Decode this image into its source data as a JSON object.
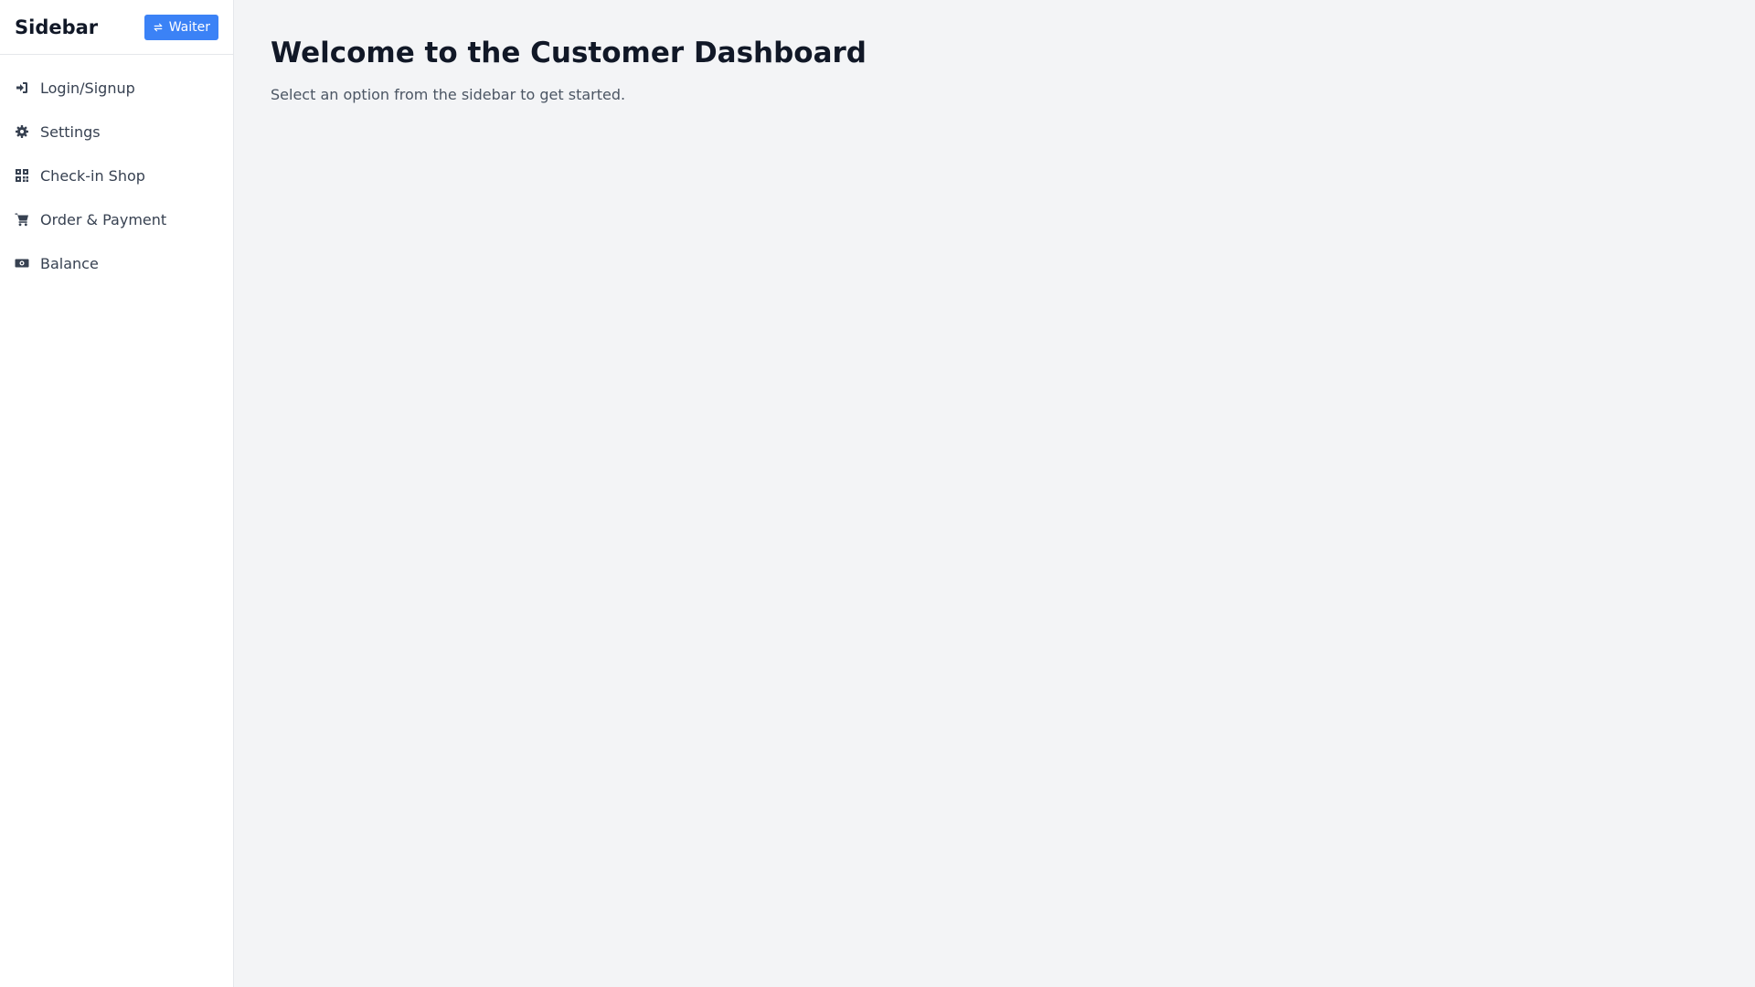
{
  "sidebar": {
    "title": "Sidebar",
    "switch_button": {
      "label": "Waiter",
      "icon": "swap-arrows-icon"
    },
    "items": [
      {
        "label": "Login/Signup",
        "icon": "sign-in-icon"
      },
      {
        "label": "Settings",
        "icon": "gear-icon"
      },
      {
        "label": "Check-in Shop",
        "icon": "qr-code-icon"
      },
      {
        "label": "Order & Payment",
        "icon": "cart-icon"
      },
      {
        "label": "Balance",
        "icon": "money-bill-icon"
      }
    ]
  },
  "main": {
    "title": "Welcome to the Customer Dashboard",
    "subtitle": "Select an option from the sidebar to get started."
  },
  "colors": {
    "accent": "#3b82f6",
    "background": "#f3f4f6",
    "sidebar_bg": "#ffffff",
    "text_primary": "#111827",
    "text_secondary": "#374151"
  }
}
